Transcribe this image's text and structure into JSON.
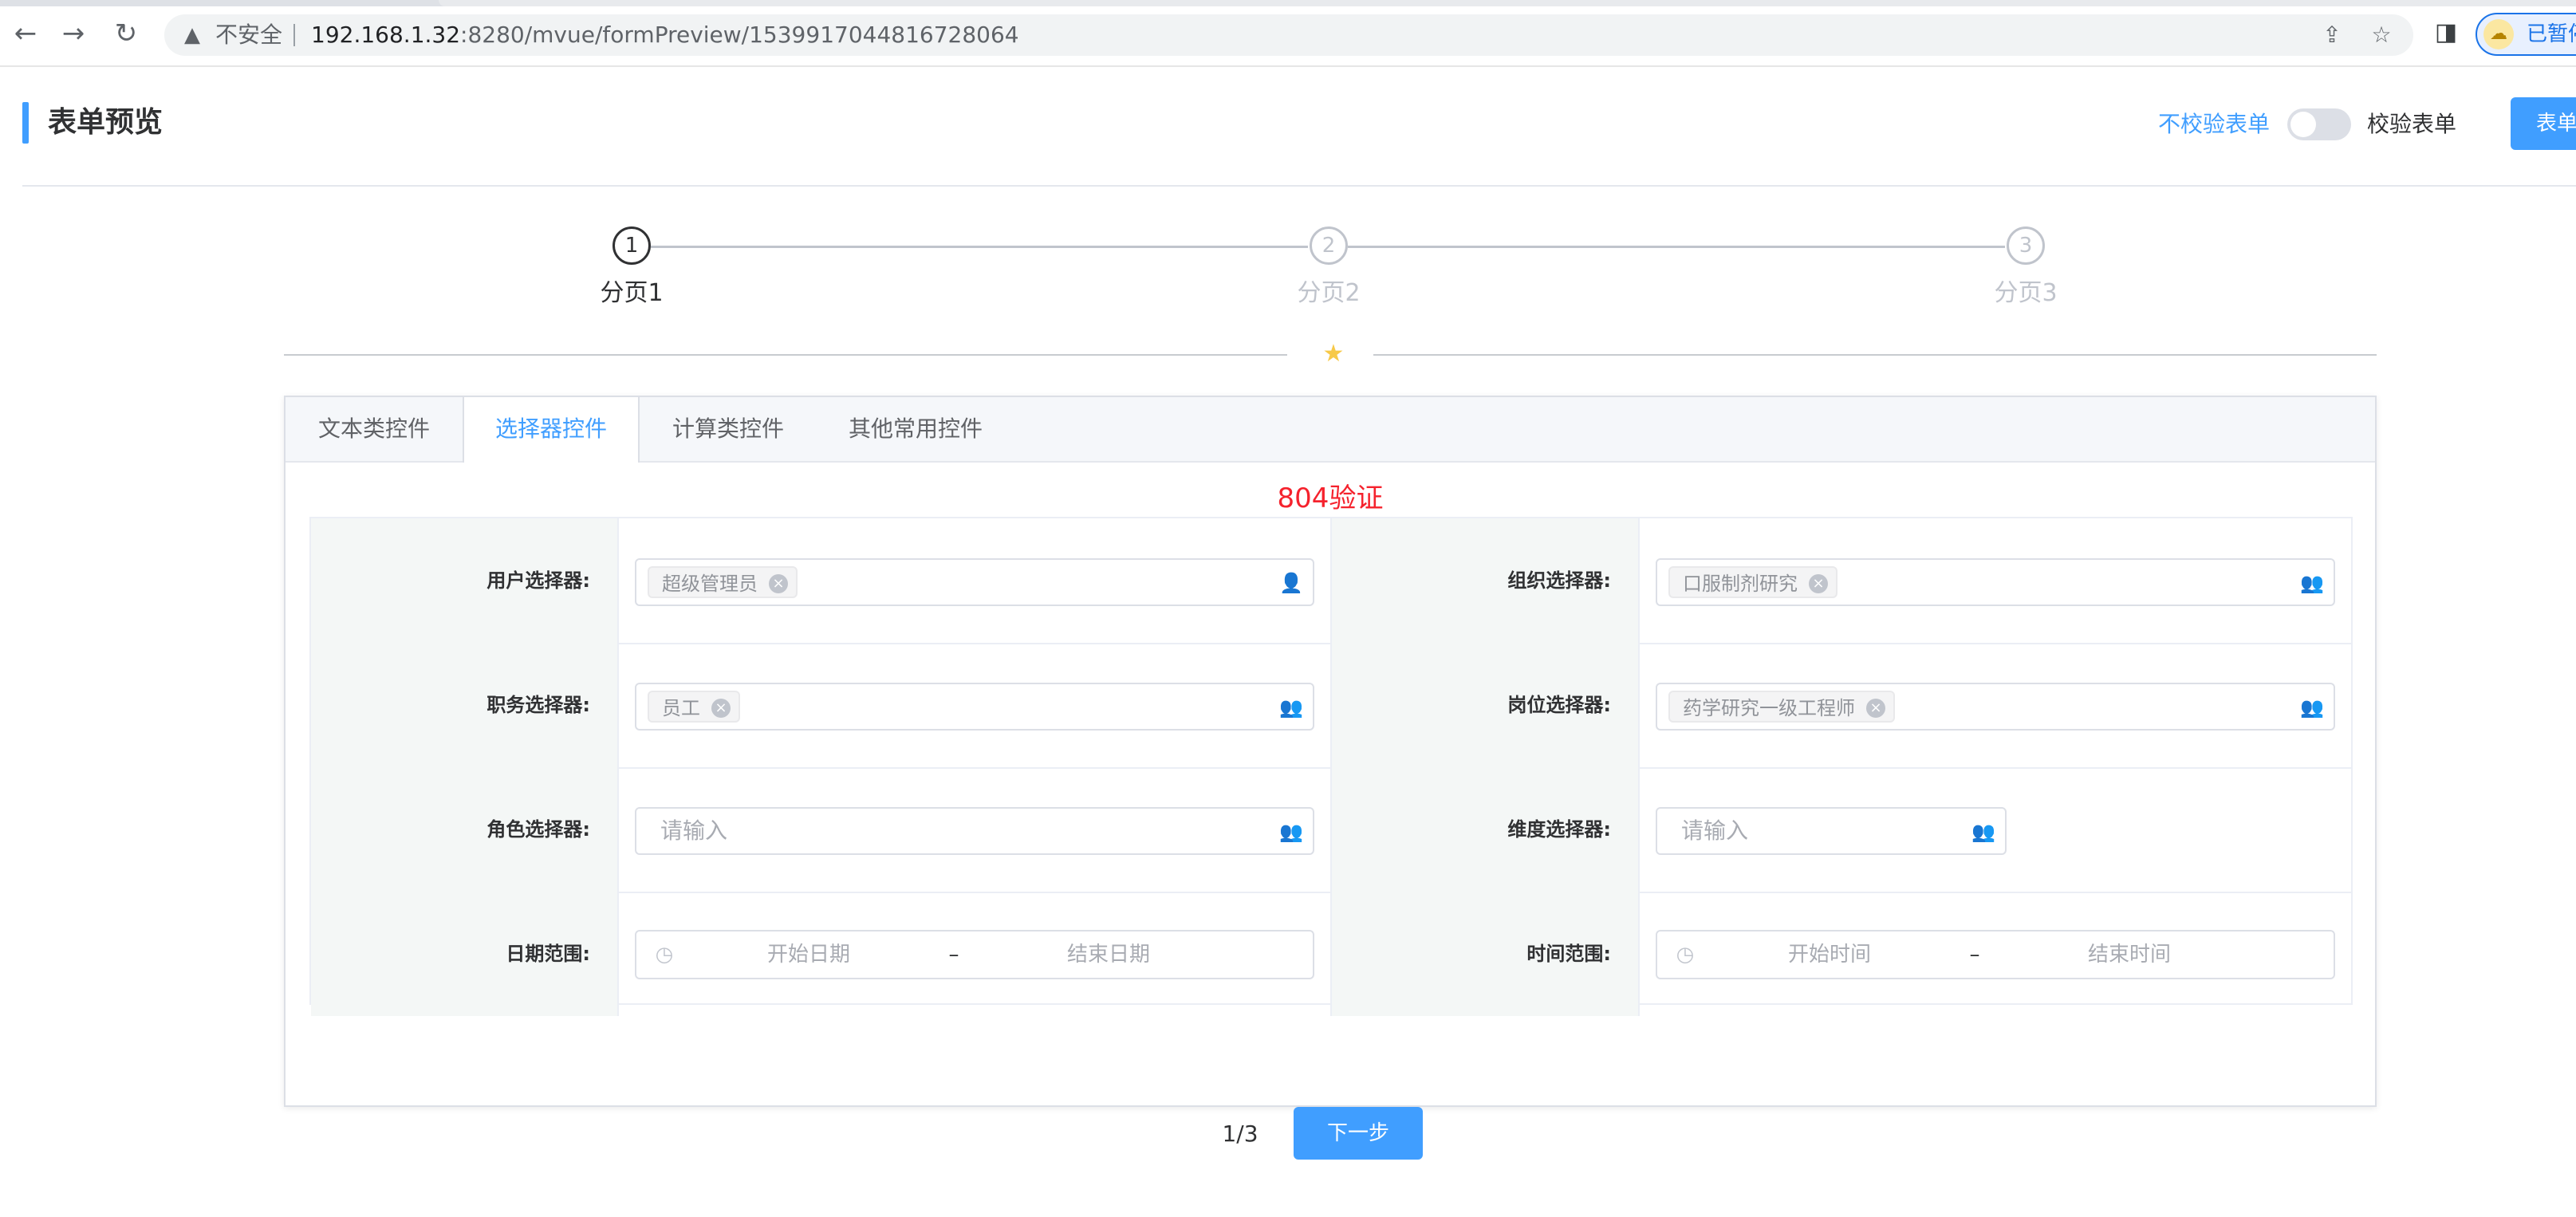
{
  "browser": {
    "insecure_label": "不安全",
    "url_host": "192.168.1.32",
    "url_rest": ":8280/mvue/formPreview/1539917044816728064",
    "profile_label": "已暂停"
  },
  "header": {
    "title": "表单预览",
    "no_validate_label": "不校验表单",
    "validate_label": "校验表单",
    "action_button_label": "表单",
    "validate_switch_on": false
  },
  "steps": [
    {
      "number": "1",
      "label": "分页1",
      "active": true
    },
    {
      "number": "2",
      "label": "分页2",
      "active": false
    },
    {
      "number": "3",
      "label": "分页3",
      "active": false
    }
  ],
  "tabs": [
    {
      "label": "文本类控件",
      "active": false
    },
    {
      "label": "选择器控件",
      "active": true
    },
    {
      "label": "计算类控件",
      "active": false
    },
    {
      "label": "其他常用控件",
      "active": false
    }
  ],
  "form": {
    "title": "804验证",
    "user_selector": {
      "label": "用户选择器:",
      "tag": "超级管理员"
    },
    "org_selector": {
      "label": "组织选择器:",
      "tag": "口服制剂研究"
    },
    "job_selector": {
      "label": "职务选择器:",
      "tag": "员工"
    },
    "post_selector": {
      "label": "岗位选择器:",
      "tag": "药学研究一级工程师"
    },
    "role_selector": {
      "label": "角色选择器:",
      "placeholder": "请输入"
    },
    "dimension_selector": {
      "label": "维度选择器:",
      "placeholder": "请输入"
    },
    "date_range": {
      "label": "日期范围:",
      "start_placeholder": "开始日期",
      "separator": "–",
      "end_placeholder": "结束日期"
    },
    "time_range": {
      "label": "时间范围:",
      "start_placeholder": "开始时间",
      "separator": "–",
      "end_placeholder": "结束时间"
    }
  },
  "pager": {
    "page_indicator": "1/3",
    "next_label": "下一步"
  },
  "colors": {
    "primary": "#409eff",
    "form_title": "#f5222d",
    "label_cell_bg": "#f4f7f6"
  }
}
